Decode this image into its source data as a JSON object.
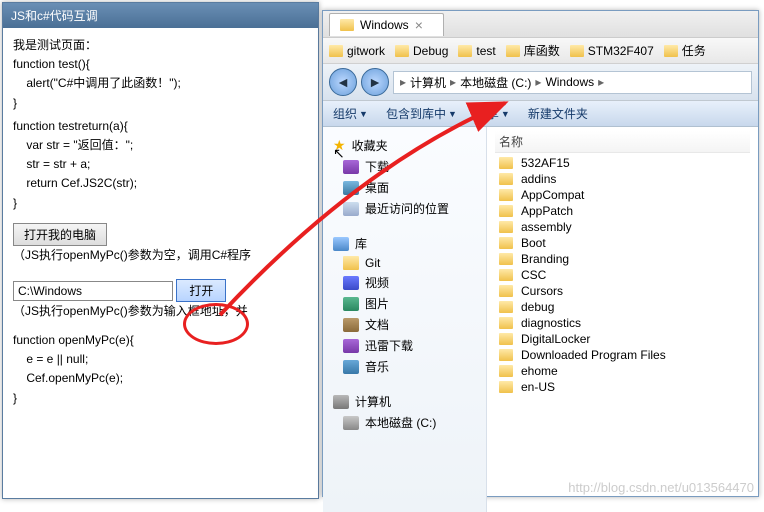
{
  "left_window": {
    "title": "JS和c#代码互调",
    "page_text": "我是测试页面：",
    "code1_l1": "function test(){",
    "code1_l2": "    alert(\"C#中调用了此函数！\");",
    "code1_l3": "}",
    "code2_l1": "function testreturn(a){",
    "code2_l2": "    var str = \"返回值：\";",
    "code2_l3": "    str = str + a;",
    "code2_l4": "    return Cef.JS2C(str);",
    "code2_l5": "}",
    "btn_open_pc": "打开我的电脑",
    "note1": "（JS执行openMyPc()参数为空，调用C#程序",
    "input_path": "C:\\Windows",
    "btn_open": "打开",
    "note2": "（JS执行openMyPc()参数为输入框地址，并",
    "code3_l1": "function openMyPc(e){",
    "code3_l2": "    e = e || null;",
    "code3_l3": "    Cef.openMyPc(e);",
    "code3_l4": "}"
  },
  "explorer": {
    "tab_title": "Windows",
    "bookmarks": [
      "gitwork",
      "Debug",
      "test",
      "库函数",
      "STM32F407",
      "任务"
    ],
    "crumbs": [
      "计算机",
      "本地磁盘 (C:)",
      "Windows"
    ],
    "toolbar": {
      "org": "组织",
      "inc": "包含到库中",
      "share": "共享",
      "new": "新建文件夹"
    },
    "tree": {
      "fav": "收藏夹",
      "dl": "下载",
      "desk": "桌面",
      "recent": "最近访问的位置",
      "lib": "库",
      "git": "Git",
      "vid": "视频",
      "pic": "图片",
      "doc": "文档",
      "xdl": "迅雷下载",
      "mus": "音乐",
      "comp": "计算机",
      "disk": "本地磁盘 (C:)"
    },
    "list_header": "名称",
    "items": [
      "532AF15",
      "addins",
      "AppCompat",
      "AppPatch",
      "assembly",
      "Boot",
      "Branding",
      "CSC",
      "Cursors",
      "debug",
      "diagnostics",
      "DigitalLocker",
      "Downloaded Program Files",
      "ehome",
      "en-US"
    ]
  },
  "watermark": "http://blog.csdn.net/u013564470"
}
